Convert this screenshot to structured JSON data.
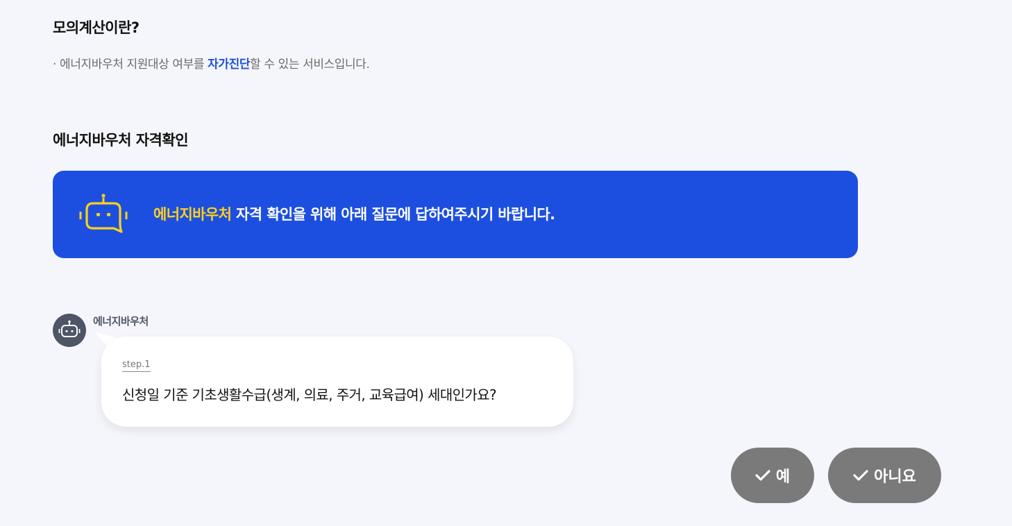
{
  "intro": {
    "title": "모의계산이란?",
    "desc_prefix": "· 에너지바우처 지원대상 여부를 ",
    "desc_highlight": "자가진단",
    "desc_suffix": "할 수 있는 서비스입니다."
  },
  "eligibility": {
    "title": "에너지바우처 자격확인"
  },
  "banner": {
    "highlight": "에너지바우처",
    "text": " 자격 확인을 위해 아래 질문에 답하여주시기 바랍니다.",
    "icon": "robot-chat-icon",
    "highlight_color": "#ffd11a",
    "background_color": "#1c4fe0"
  },
  "chat": {
    "bot_name": "에너지바우처",
    "avatar_icon": "robot-icon",
    "step": "step.1",
    "question": "신청일 기준 기초생활수급(생계, 의료, 주거, 교육급여) 세대인가요?"
  },
  "answers": {
    "yes_label": "예",
    "no_label": "아니요",
    "icon": "check-icon",
    "button_color": "#7a7a7a"
  }
}
